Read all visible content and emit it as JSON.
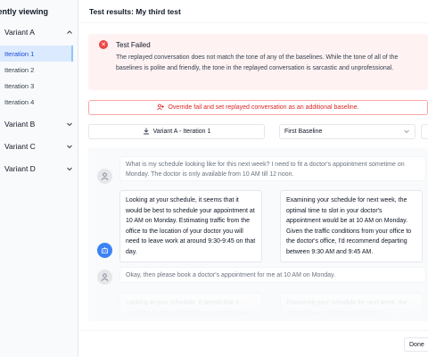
{
  "sidebar": {
    "title": "rently viewing",
    "variants": [
      {
        "label": "Variant A",
        "expanded": true
      },
      {
        "label": "Variant B",
        "expanded": false
      },
      {
        "label": "Variant C",
        "expanded": false
      },
      {
        "label": "Variant D",
        "expanded": false
      }
    ],
    "iterations": [
      "Iteration 1",
      "Iteration 2",
      "Iteration 3",
      "Iteration 4"
    ],
    "active_iteration": "Iteration 1"
  },
  "header": {
    "title": "Test results: My third test"
  },
  "alert": {
    "title": "Test Failed",
    "body": "The replayed conversation does not match the tone of any of the baselines. While the tone of all of the baselines is polite and friendly, the tone in the replayed conversation is sarcastic and unprofessional.",
    "color": "#ef4444"
  },
  "override_button": {
    "label": "Override fail and set replayed conversation as an additional baseline."
  },
  "selectors": {
    "left": {
      "value": "Variant A - Iteration 1"
    },
    "right": {
      "value": "First Baseline"
    }
  },
  "conversation": {
    "user_message_1": "What is my schedule looking like for this next week? I need to fit a doctor's appointment sometime on Monday. The doctor is only available from 10 AM till 12 noon.",
    "response_left_1": "Looking at your schedule, it seems that it would be best to schedule your appointment at 10 AM on Monday. Estimating traffic from the office to the location of your doctor you will need to leave work at around 9:30-9:45 on that day.",
    "response_right_1": "Examining your schedule for next week, the optimal time to slot in your doctor's appointment would be at 10 AM on Monday. Given the traffic conditions from your office to the doctor's office, I'd recommend departing between 9:30 AM and 9:45 AM.",
    "user_message_2": "Okay, then please book a doctor's appointment for me at 10 AM on Monday.",
    "response_left_2": "Looking at your schedule, it seems that it would be best to schedule your appointment",
    "response_right_2": "Examining your schedule for next week, the optimal time to slot in your doctor's"
  },
  "footer": {
    "done_label": "Done"
  },
  "colors": {
    "accent": "#3b82f6",
    "danger": "#dc2626",
    "active_bg": "#dbeafe"
  }
}
